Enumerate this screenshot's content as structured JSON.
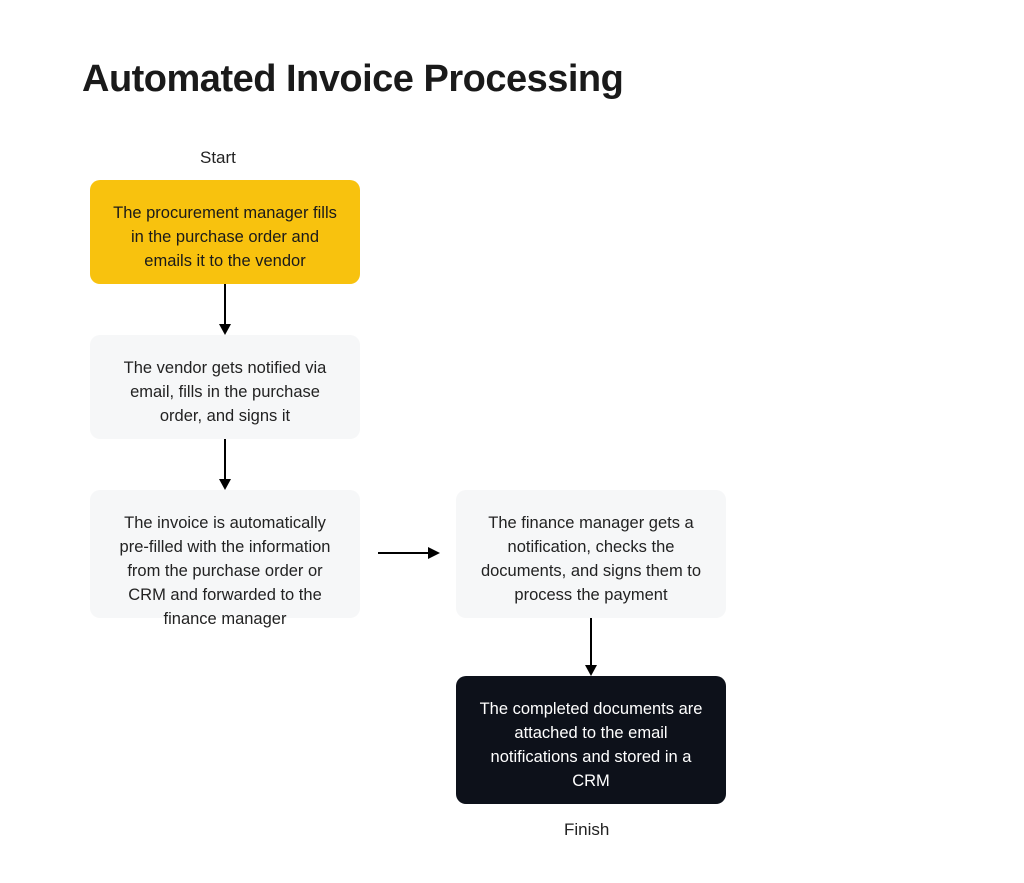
{
  "title": "Automated Invoice Processing",
  "labels": {
    "start": "Start",
    "finish": "Finish"
  },
  "nodes": {
    "n1": "The procurement manager fills in the purchase order and emails it to the vendor",
    "n2": "The vendor gets notified via email, fills in the purchase order, and signs it",
    "n3": "The invoice is automatically pre-filled with the information from the purchase order or CRM and forwarded to the finance manager",
    "n4": "The finance manager gets a notification, checks the documents, and signs them to process the payment",
    "n5": "The completed documents are attached to the email notifications and stored in a CRM"
  },
  "colors": {
    "yellow": "#f8c20e",
    "gray": "#f6f7f8",
    "dark": "#0d111a"
  },
  "edges": [
    {
      "from": "n1",
      "to": "n2",
      "direction": "down"
    },
    {
      "from": "n2",
      "to": "n3",
      "direction": "down"
    },
    {
      "from": "n3",
      "to": "n4",
      "direction": "right"
    },
    {
      "from": "n4",
      "to": "n5",
      "direction": "down"
    }
  ]
}
